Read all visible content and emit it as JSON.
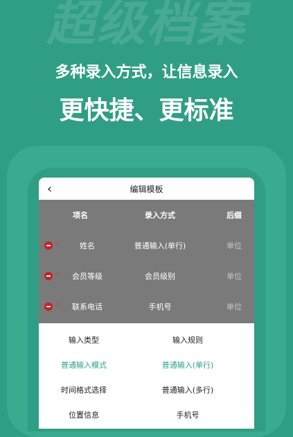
{
  "banner": {
    "bg_word": "超级档案",
    "headline_1": "多种录入方式，让信息录入",
    "headline_2": "更快捷、更标准"
  },
  "screen": {
    "title": "编辑模板",
    "table": {
      "headers": [
        "项名",
        "录入方式",
        "后缀"
      ],
      "rows": [
        {
          "name": "姓名",
          "method": "普通输入(单行)",
          "suffix": "单位"
        },
        {
          "name": "会员等级",
          "method": "会员级别",
          "suffix": "单位"
        },
        {
          "name": "联系电话",
          "method": "手机号",
          "suffix": "单位"
        }
      ]
    },
    "sheet": {
      "left_header": "输入类型",
      "right_header": "输入规则",
      "rows": [
        {
          "left": "普通输入模式",
          "right": "普通输入(单行)",
          "active": true
        },
        {
          "left": "时间格式选择",
          "right": "普通输入(多行)",
          "active": false
        },
        {
          "left": "位置信息",
          "right": "手机号",
          "active": false
        }
      ]
    }
  },
  "colors": {
    "background": "#2f9e84",
    "accent": "#2fa08a",
    "remove": "#c0232a",
    "overlay": "#7a7a7a"
  }
}
